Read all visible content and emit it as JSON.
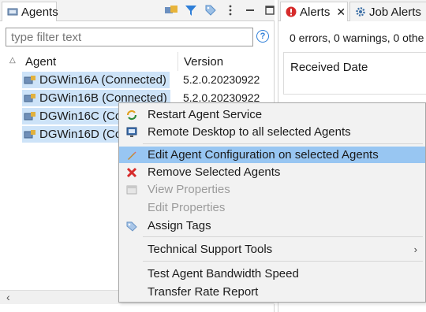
{
  "agents_view": {
    "tab_label": "Agents",
    "filter_placeholder": "type filter text",
    "columns": [
      "Agent",
      "Version"
    ],
    "rows": [
      {
        "name": "DGWin16A (Connected)",
        "version": "5.2.0.20230922"
      },
      {
        "name": "DGWin16B (Connected)",
        "version": "5.2.0.20230922"
      },
      {
        "name": "DGWin16C (Co",
        "version": ""
      },
      {
        "name": "DGWin16D (Co",
        "version": ""
      }
    ],
    "help_label": "?"
  },
  "right_view": {
    "tabs": [
      "Alerts",
      "Job Alerts"
    ],
    "summary": "0 errors, 0 warnings, 0 othe",
    "column_header": "Received Date"
  },
  "context_menu": {
    "items": [
      {
        "label": "Restart Agent Service",
        "icon": "restart-icon"
      },
      {
        "label": "Remote Desktop to all selected Agents",
        "icon": "monitor-icon"
      },
      {
        "label": "Edit Agent Configuration on selected Agents",
        "icon": "pencil-icon"
      },
      {
        "label": "Remove Selected Agents",
        "icon": "red-x-icon"
      },
      {
        "label": "View Properties",
        "icon": "properties-icon"
      },
      {
        "label": "Edit Properties",
        "icon": ""
      },
      {
        "label": "Assign Tags",
        "icon": "tag-icon"
      },
      {
        "label": "Technical Support Tools",
        "icon": ""
      },
      {
        "label": "Test Agent Bandwidth Speed",
        "icon": ""
      },
      {
        "label": "Transfer Rate Report",
        "icon": ""
      }
    ]
  },
  "colors": {
    "selection": "#cde3f8",
    "menu_highlight": "#98c6f2",
    "accent": "#2f7fd8",
    "danger": "#d62b2b"
  }
}
